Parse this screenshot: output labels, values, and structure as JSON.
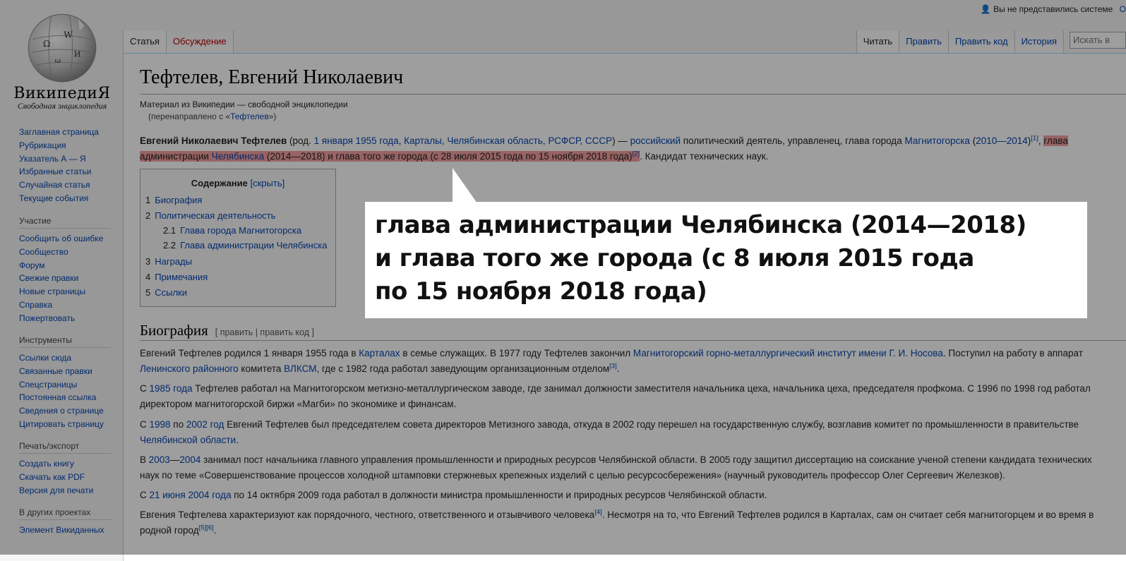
{
  "logo": {
    "wordmark": "ВикипедиЯ",
    "slogan": "Свободная энциклопедия"
  },
  "sidebar": {
    "nav": [
      "Заглавная страница",
      "Рубрикация",
      "Указатель А — Я",
      "Избранные статьи",
      "Случайная статья",
      "Текущие события"
    ],
    "participation": {
      "title": "Участие",
      "items": [
        "Сообщить об ошибке",
        "Сообщество",
        "Форум",
        "Свежие правки",
        "Новые страницы",
        "Справка",
        "Пожертвовать"
      ]
    },
    "tools": {
      "title": "Инструменты",
      "items": [
        "Ссылки сюда",
        "Связанные правки",
        "Спецстраницы",
        "Постоянная ссылка",
        "Сведения о странице",
        "Цитировать страницу"
      ]
    },
    "print": {
      "title": "Печать/экспорт",
      "items": [
        "Создать книгу",
        "Скачать как PDF",
        "Версия для печати"
      ]
    },
    "projects": {
      "title": "В других проектах",
      "items": [
        "Элемент Викиданных"
      ]
    }
  },
  "personal": {
    "text": "Вы не представились системе",
    "extra": "О"
  },
  "tabs": {
    "article": "Статья",
    "talk": "Обсуждение",
    "read": "Читать",
    "edit": "Править",
    "edit_source": "Править код",
    "history": "История"
  },
  "search": {
    "placeholder": "Искать в"
  },
  "article": {
    "title": "Тефтелев, Евгений Николаевич",
    "site_sub": "Материал из Википедии — свободной энциклопедии",
    "redirect_prefix": "(перенаправлено с «",
    "redirect_link": "Тефтелев",
    "redirect_suffix": "»)",
    "lead": {
      "name": "Евгений Николаевич Тефтелев",
      "rod": " (род. ",
      "birth": "1 января 1955 года, Карталы, Челябинская область, РСФСР, СССР",
      "dash": ") — ",
      "nationality": "российский",
      "t1": " политический деятель, управленец, глава города ",
      "city": "Магнитогорска",
      "t2": " (",
      "years": "2010—2014",
      "t3": ")",
      "ref1": "[1]",
      "comma": ", ",
      "hl1": "глава",
      "hl2": "администрации ",
      "hl_city": "Челябинска",
      "hl3": " (2014—2018) и глава того же города (с 28 июля 2015 года по 15 ноября 2018 года)",
      "ref2": "[2]",
      "t4": ". Кандидат технических наук."
    },
    "toc": {
      "title": "Содержание",
      "toggle": "[скрыть]",
      "items": [
        {
          "num": "1",
          "label": "Биография"
        },
        {
          "num": "2",
          "label": "Политическая деятельность"
        },
        {
          "num": "2.1",
          "label": "Глава города Магнитогорска"
        },
        {
          "num": "2.2",
          "label": "Глава администрации Челябинска"
        },
        {
          "num": "3",
          "label": "Награды"
        },
        {
          "num": "4",
          "label": "Примечания"
        },
        {
          "num": "5",
          "label": "Ссылки"
        }
      ]
    },
    "bio_heading": "Биография",
    "bio_edit": "[ править | править код ]",
    "p1": {
      "a": "Евгений Тефтелев родился 1 января 1955 года в ",
      "l1": "Карталах",
      "b": " в семье служащих. В 1977 году Тефтелев закончил ",
      "l2": "Магнитогорский горно-металлургический институт имени Г. И. Носова",
      "c": ". Поступил на работу в аппарат ",
      "l3": "Ленинского районного",
      "d": " комитета ",
      "l4": "ВЛКСМ",
      "e": ", где с 1982 года работал заведующим организационным отделом",
      "ref": "[3]",
      "f": "."
    },
    "p2": {
      "a": "С ",
      "l1": "1985 года",
      "b": " Тефтелев работал на Магнитогорском метизно-металлургическом заводе, где занимал должности заместителя начальника цеха, начальника цеха, председателя профкома. С 1996 по 1998 год работал директором магнитогорской биржи «Магби» по экономике и финансам."
    },
    "p3": {
      "a": "С ",
      "l1": "1998",
      "b": " по ",
      "l2": "2002 год",
      "c": " Евгений Тефтелев был председателем совета директоров Метизного завода, откуда в 2002 году перешел на государственную службу, возглавив комитет по промышленности в правительстве ",
      "l3": "Челябинской области",
      "d": "."
    },
    "p4": {
      "a": "В ",
      "l1": "2003",
      "dash": "—",
      "l2": "2004",
      "b": " занимал пост начальника главного управления промышленности и природных ресурсов Челябинской области. В 2005 году защитил диссертацию на соискание ученой степени кандидата технических наук по теме «Совершенствование процессов холодной штамповки стержневых крепежных изделий с целью ресурсосбережения» (научный руководитель профессор Олег Сергеевич Железков)."
    },
    "p5": {
      "a": "С ",
      "l1": "21 июня 2004 года",
      "b": " по 14 октября 2009 года работал в должности министра промышленности и природных ресурсов Челябинской области."
    },
    "p6": {
      "a": "Евгения Тефтелева характеризуют как порядочного, честного, ответственного и отзывчивого человека",
      "ref1": "[4]",
      "b": ". Несмотря на то, что Евгений Тефтелев родился в Карталах, сам он считает себя магнитогорцем и во время в родной город",
      "ref2": "[5]",
      "ref3": "[6]",
      "c": "."
    }
  },
  "callout": {
    "line1": "глава администрации Челябинска (2014—2018)",
    "line2": "и глава того же города (с 8 июля 2015 года",
    "line3": "по 15 ноября 2018 года)"
  },
  "colors": {
    "link": "#0645ad",
    "highlight": "#f6a0a0",
    "new_link": "#ba0000"
  }
}
